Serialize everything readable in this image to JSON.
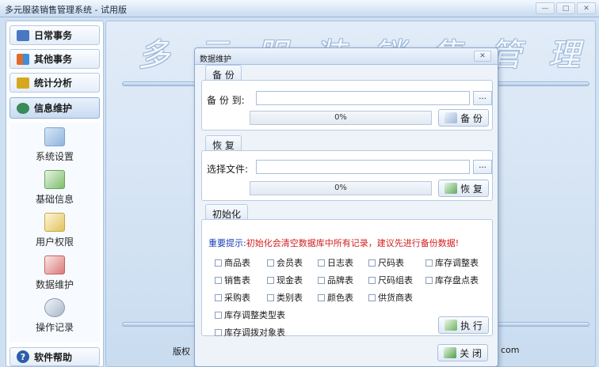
{
  "app": {
    "title": "多元服装销售管理系统 - 试用版"
  },
  "window_controls": [
    "—",
    "□",
    "✕"
  ],
  "sidebar": {
    "nav": [
      {
        "label": "日常事务",
        "icon": "book-icon",
        "color": "#4a78c0"
      },
      {
        "label": "其他事务",
        "icon": "grid-icon",
        "color": "#e06a2a"
      },
      {
        "label": "统计分析",
        "icon": "cube-icon",
        "color": "#d6a81e"
      },
      {
        "label": "信息维护",
        "icon": "gears-icon",
        "color": "#3a8a5a"
      }
    ],
    "panel_items": [
      {
        "label": "系统设置",
        "icon": "settings-icon"
      },
      {
        "label": "基础信息",
        "icon": "basic-info-icon"
      },
      {
        "label": "用户权限",
        "icon": "user-permissions-icon"
      },
      {
        "label": "数据维护",
        "icon": "data-maintenance-icon"
      },
      {
        "label": "操作记录",
        "icon": "operation-log-icon"
      }
    ],
    "help": "软件帮助"
  },
  "content": {
    "banner": "多元服装销售管理系统",
    "footer_left": "版权",
    "footer_right": "com"
  },
  "dialog": {
    "title": "数据维护",
    "close": "✕",
    "backup": {
      "tab": "备 份",
      "label": "备 份 到:",
      "value": "",
      "browse": "...",
      "progress_text": "0%",
      "progress": 0,
      "button": "备 份"
    },
    "restore": {
      "tab": "恢 复",
      "label": "选择文件:",
      "value": "",
      "browse": "...",
      "progress_text": "0%",
      "progress": 0,
      "button": "恢 复"
    },
    "init": {
      "tab": "初始化",
      "warning_key": "重要提示:",
      "warning_msg": "初始化会清空数据库中所有记录，建议先进行备份数据!",
      "tables": [
        "商品表",
        "会员表",
        "日志表",
        "尺码表",
        "库存调整表",
        "销售表",
        "现金表",
        "品牌表",
        "尺码组表",
        "库存盘点表",
        "采购表",
        "类别表",
        "颜色表",
        "供货商表",
        "库存调整类型表",
        "库存调拨对象表"
      ],
      "execute": "执 行"
    },
    "close_button": "关 闭"
  },
  "colors": {
    "accent_blue": "#1b3fb5",
    "warning_red": "#d21d1d",
    "frame": "#a8c2e0"
  }
}
